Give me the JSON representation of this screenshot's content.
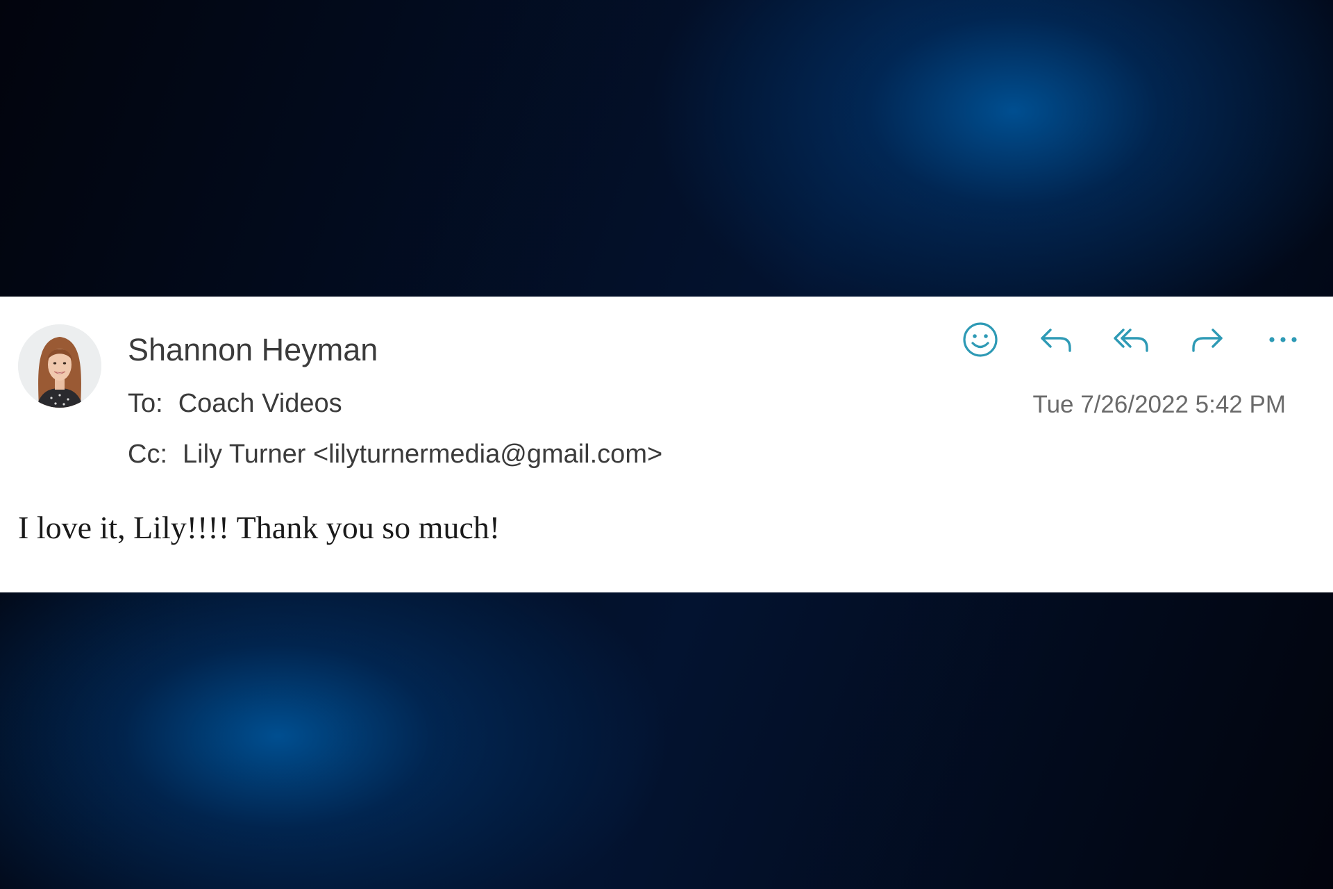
{
  "email": {
    "sender": {
      "name": "Shannon Heyman"
    },
    "to": {
      "label": "To:",
      "value": "Coach Videos"
    },
    "cc": {
      "label": "Cc:",
      "value": "Lily Turner <lilyturnermedia@gmail.com>"
    },
    "timestamp": "Tue 7/26/2022 5:42 PM",
    "body": "I love it, Lily!!!! Thank you so much!"
  },
  "actions": [
    {
      "icon": "smiley-icon"
    },
    {
      "icon": "reply-icon"
    },
    {
      "icon": "reply-all-icon"
    },
    {
      "icon": "forward-icon"
    },
    {
      "icon": "more-icon"
    }
  ],
  "colors": {
    "accent": "#2e9ab5",
    "text": "#3b3b3b",
    "muted": "#6a6a6a",
    "background_dark": "#02040d",
    "background_glow": "#00528f"
  }
}
